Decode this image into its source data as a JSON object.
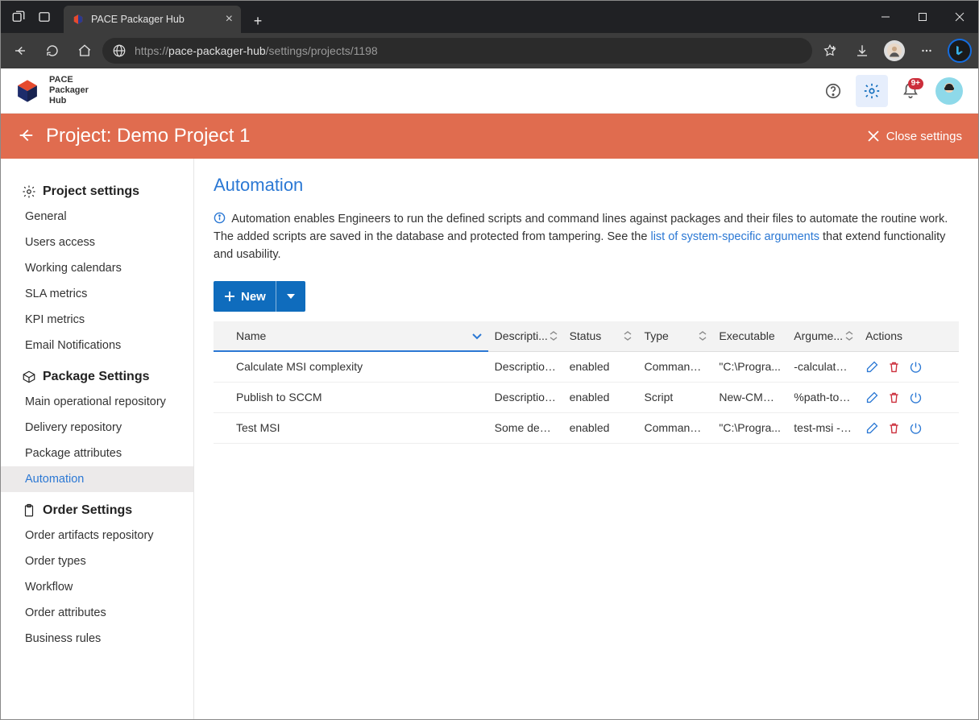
{
  "browser": {
    "tab_title": "PACE Packager Hub",
    "url_scheme": "https://",
    "url_host": "pace-packager-hub",
    "url_path": "/settings/projects/1198"
  },
  "app_header": {
    "brand_line1": "PACE",
    "brand_line2": "Packager",
    "brand_line3": "Hub",
    "notification_badge": "9+"
  },
  "sub_header": {
    "title": "Project: Demo Project 1",
    "close_label": "Close settings"
  },
  "sidebar": {
    "section1_title": "Project settings",
    "section1_items": [
      "General",
      "Users access",
      "Working calendars",
      "SLA metrics",
      "KPI metrics",
      "Email Notifications"
    ],
    "section2_title": "Package Settings",
    "section2_items": [
      "Main operational repository",
      "Delivery repository",
      "Package attributes",
      "Automation"
    ],
    "section3_title": "Order Settings",
    "section3_items": [
      "Order artifacts repository",
      "Order types",
      "Workflow",
      "Order attributes",
      "Business rules"
    ],
    "active_item": "Automation"
  },
  "main": {
    "page_title": "Automation",
    "info_prefix": "Automation enables Engineers to run the defined scripts and command lines against packages and their files to automate the routine work. The added scripts are saved in the database and protected from tampering. See the ",
    "info_link": "list of system-specific arguments",
    "info_suffix": " that extend functionality and usability.",
    "new_button": "New",
    "columns": {
      "name": "Name",
      "description": "Descripti...",
      "status": "Status",
      "type": "Type",
      "executable": "Executable",
      "arguments": "Argume...",
      "actions": "Actions"
    },
    "rows": [
      {
        "name": "Calculate MSI complexity",
        "description": "Description ...",
        "status": "enabled",
        "type": "Command li...",
        "executable": "\"C:\\Progra...",
        "arguments": "-calculate-c..."
      },
      {
        "name": "Publish to SCCM",
        "description": "Description ...",
        "status": "enabled",
        "type": "Script",
        "executable": "New-CMAp...",
        "arguments": "%path-to-o..."
      },
      {
        "name": "Test MSI",
        "description": "Some descr...",
        "status": "enabled",
        "type": "Command li...",
        "executable": "\"C:\\Progra...",
        "arguments": "test-msi --v..."
      }
    ]
  }
}
